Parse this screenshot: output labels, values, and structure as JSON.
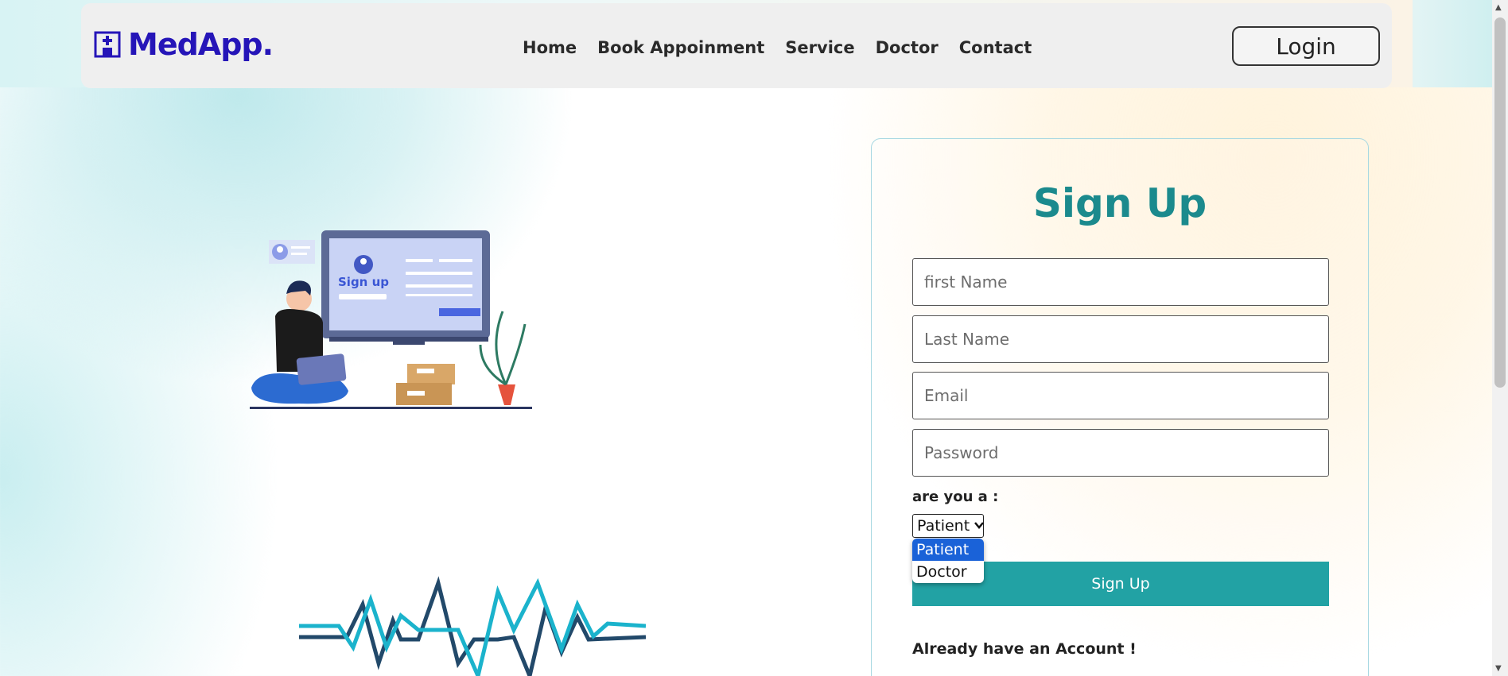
{
  "brand": {
    "name": "MedApp.",
    "icon": "hospital-icon"
  },
  "nav": {
    "items": [
      "Home",
      "Book Appoinment",
      "Service",
      "Doctor",
      "Contact"
    ],
    "login_label": "Login"
  },
  "signup": {
    "title": "Sign Up",
    "first_name_placeholder": "first Name",
    "last_name_placeholder": "Last Name",
    "email_placeholder": "Email",
    "password_placeholder": "Password",
    "role_label": "are you a :",
    "role_selected": "Patient",
    "role_options": [
      "Patient",
      "Doctor"
    ],
    "submit_label": "Sign Up",
    "already_text": "Already have an Account !"
  },
  "colors": {
    "brand": "#2515b8",
    "title": "#1b8a8d",
    "button": "#22a2a4",
    "dropdown_selected": "#1a62d8"
  }
}
